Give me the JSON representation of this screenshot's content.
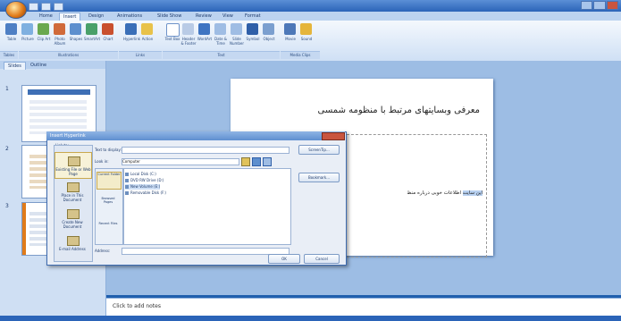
{
  "window": {
    "title": ""
  },
  "tabs": [
    "Home",
    "Insert",
    "Design",
    "Animations",
    "Slide Show",
    "Review",
    "View",
    "Format"
  ],
  "active_tab": "Insert",
  "ribbon": {
    "groups": [
      "Tables",
      "Illustrations",
      "Links",
      "Text",
      "Media Clips"
    ],
    "buttons": [
      "Table",
      "Picture",
      "Clip Art",
      "Photo Album",
      "Shapes",
      "SmartArt",
      "Chart",
      "Hyperlink",
      "Action",
      "Text Box",
      "Header & Footer",
      "WordArt",
      "Date & Time",
      "Slide Number",
      "Symbol",
      "Object",
      "Movie",
      "Sound"
    ]
  },
  "pane_tabs": [
    "Slides",
    "Outline"
  ],
  "slide_thumbnails": [
    "1",
    "2",
    "3"
  ],
  "slide": {
    "title": "معرفی وبسایتهای مرتبط با منظومه شمسی",
    "body_selected": "این سایت",
    "body_rest": " اطلاعات خوبی درباره منظ"
  },
  "notes_placeholder": "Click to add notes",
  "dialog": {
    "title": "Insert Hyperlink",
    "link_to_label": "Link to:",
    "link_options": [
      "Existing File or Web Page",
      "Place in This Document",
      "Create New Document",
      "E-mail Address"
    ],
    "text_to_display_label": "Text to display:",
    "text_to_display_value": "",
    "screentip_button": "ScreenTip...",
    "look_in_label": "Look in:",
    "look_in_value": "Computer",
    "folder_sidebar": [
      "Current Folder",
      "Browsed Pages",
      "Recent Files"
    ],
    "files": [
      "Local Disk (C:)",
      "DVD RW Drive (D:)",
      "New Volume (E:)",
      "Removable Disk (F:)"
    ],
    "selected_file_index": 2,
    "bookmark_button": "Bookmark...",
    "address_label": "Address:",
    "address_value": "",
    "ok_button": "OK",
    "cancel_button": "Cancel"
  },
  "colors": {
    "frame": "#1f5fae",
    "ribbon": "#dce8f8",
    "dialog_title": "#5f8fd0",
    "close": "#c9553f"
  }
}
